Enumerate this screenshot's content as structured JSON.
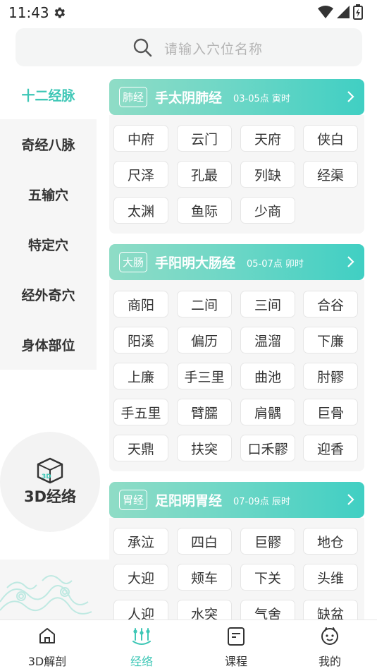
{
  "status": {
    "time": "11:43"
  },
  "search": {
    "placeholder": "请输入穴位名称"
  },
  "sidebar": {
    "items": [
      {
        "label": "十二经脉",
        "active": true
      },
      {
        "label": "奇经八脉"
      },
      {
        "label": "五输穴"
      },
      {
        "label": "特定穴"
      },
      {
        "label": "经外奇穴"
      },
      {
        "label": "身体部位"
      }
    ]
  },
  "three_d": {
    "label": "3D经络",
    "icon_text": "3D"
  },
  "meridians": [
    {
      "badge": "肺经",
      "name": "手太阴肺经",
      "time": "03-05点 寅时",
      "points": [
        "中府",
        "云门",
        "天府",
        "侠白",
        "尺泽",
        "孔最",
        "列缺",
        "经渠",
        "太渊",
        "鱼际",
        "少商"
      ]
    },
    {
      "badge": "大肠",
      "name": "手阳明大肠经",
      "time": "05-07点 卯时",
      "points": [
        "商阳",
        "二间",
        "三间",
        "合谷",
        "阳溪",
        "偏历",
        "温溜",
        "下廉",
        "上廉",
        "手三里",
        "曲池",
        "肘髎",
        "手五里",
        "臂臑",
        "肩髃",
        "巨骨",
        "天鼎",
        "扶突",
        "口禾髎",
        "迎香"
      ]
    },
    {
      "badge": "胃经",
      "name": "足阳明胃经",
      "time": "07-09点 辰时",
      "points": [
        "承泣",
        "四白",
        "巨髎",
        "地仓",
        "大迎",
        "颊车",
        "下关",
        "头维",
        "人迎",
        "水突",
        "气舍",
        "缺盆"
      ]
    }
  ],
  "tabs": [
    {
      "label": "3D解剖",
      "icon": "house-icon"
    },
    {
      "label": "经络",
      "icon": "meridian-icon",
      "active": true
    },
    {
      "label": "课程",
      "icon": "course-icon"
    },
    {
      "label": "我的",
      "icon": "profile-icon"
    }
  ],
  "colors": {
    "accent": "#3ec7b6",
    "header_start": "#8fdcc6",
    "header_end": "#40cfc3"
  }
}
